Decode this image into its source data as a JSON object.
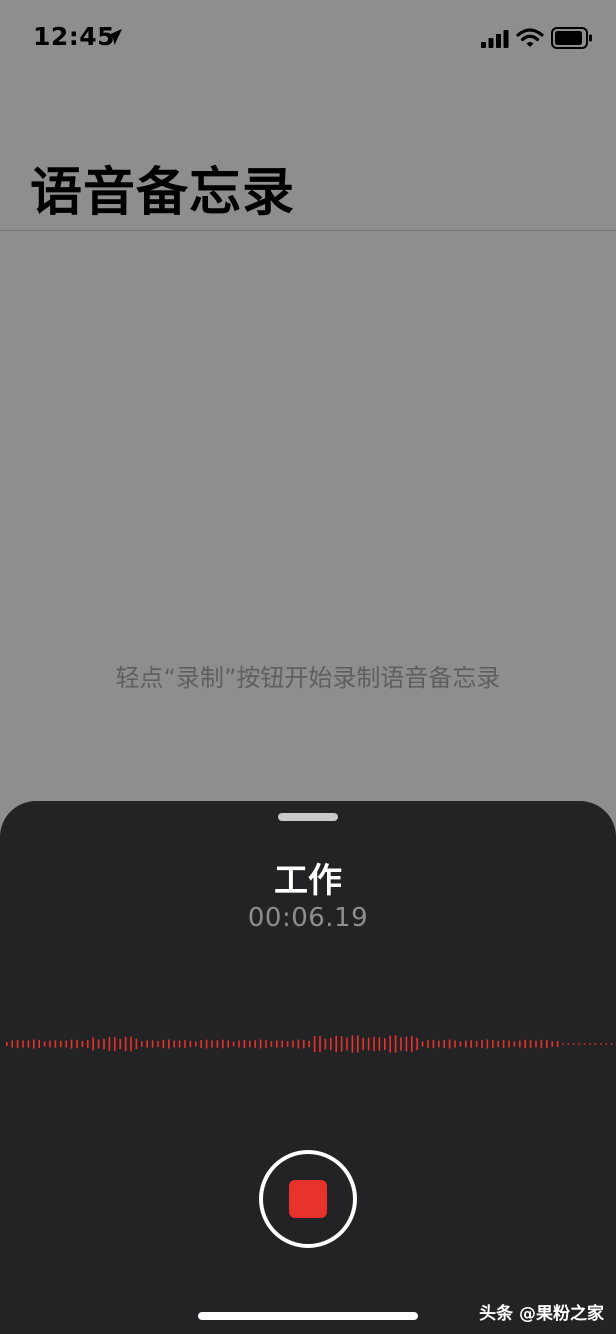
{
  "status_bar": {
    "time": "12:45",
    "icons": [
      "location-arrow-icon",
      "cellular-signal-icon",
      "wifi-icon",
      "battery-icon"
    ]
  },
  "header": {
    "title": "语音备忘录"
  },
  "empty_state": {
    "hint": "轻点“录制”按钮开始录制语音备忘录"
  },
  "recording_sheet": {
    "title": "工作",
    "elapsed": "00:06.19",
    "stop_button_icon": "stop-icon"
  },
  "watermark": {
    "text": "头条 @果粉之家"
  },
  "colors": {
    "background_dimmed": "#8e8e8e",
    "sheet_background": "#232224",
    "accent_red": "#e8322c",
    "elapsed_text": "#8e8e92"
  }
}
